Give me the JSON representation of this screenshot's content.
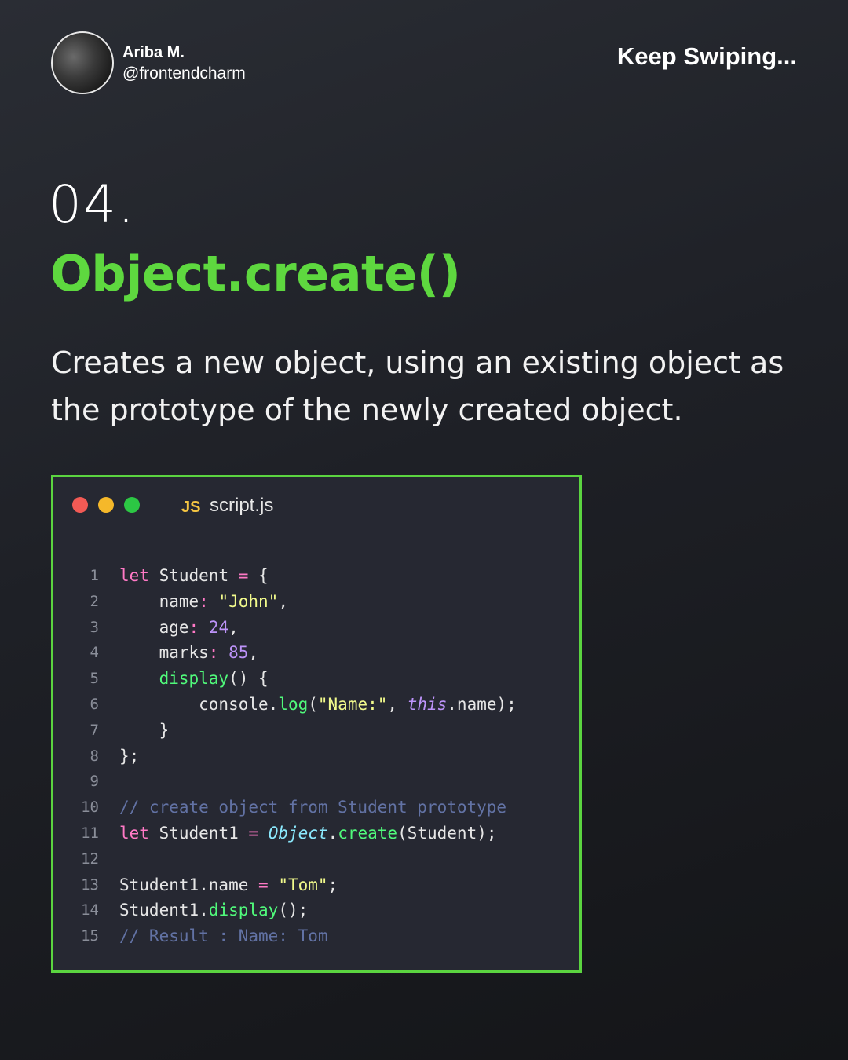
{
  "author": {
    "name": "Ariba M.",
    "handle": "@frontendcharm"
  },
  "header": {
    "cta": "Keep Swiping..."
  },
  "slide": {
    "number": "04.",
    "title": "Object.create()",
    "description": "Creates a new object, using an existing object as the prototype of the newly created object."
  },
  "editor": {
    "file_badge": "JS",
    "file_name": "script.js",
    "lines": [
      {
        "n": "1",
        "tokens": [
          [
            "keyword",
            "let"
          ],
          [
            "plain",
            " Student "
          ],
          [
            "op",
            "="
          ],
          [
            "plain",
            " {"
          ]
        ]
      },
      {
        "n": "2",
        "tokens": [
          [
            "plain",
            "    name"
          ],
          [
            "op",
            ":"
          ],
          [
            "plain",
            " "
          ],
          [
            "string",
            "\"John\""
          ],
          [
            "plain",
            ","
          ]
        ]
      },
      {
        "n": "3",
        "tokens": [
          [
            "plain",
            "    age"
          ],
          [
            "op",
            ":"
          ],
          [
            "plain",
            " "
          ],
          [
            "number",
            "24"
          ],
          [
            "plain",
            ","
          ]
        ]
      },
      {
        "n": "4",
        "tokens": [
          [
            "plain",
            "    marks"
          ],
          [
            "op",
            ":"
          ],
          [
            "plain",
            " "
          ],
          [
            "number",
            "85"
          ],
          [
            "plain",
            ","
          ]
        ]
      },
      {
        "n": "5",
        "tokens": [
          [
            "plain",
            "    "
          ],
          [
            "func",
            "display"
          ],
          [
            "plain",
            "() {"
          ]
        ]
      },
      {
        "n": "6",
        "tokens": [
          [
            "plain",
            "        console."
          ],
          [
            "func",
            "log"
          ],
          [
            "plain",
            "("
          ],
          [
            "string",
            "\"Name:\""
          ],
          [
            "plain",
            ", "
          ],
          [
            "this",
            "this"
          ],
          [
            "plain",
            ".name);"
          ]
        ]
      },
      {
        "n": "7",
        "tokens": [
          [
            "plain",
            "    }"
          ]
        ]
      },
      {
        "n": "8",
        "tokens": [
          [
            "plain",
            "};"
          ]
        ]
      },
      {
        "n": "9",
        "tokens": []
      },
      {
        "n": "10",
        "tokens": [
          [
            "comment",
            "// create object from Student prototype"
          ]
        ]
      },
      {
        "n": "11",
        "tokens": [
          [
            "keyword",
            "let"
          ],
          [
            "plain",
            " Student1 "
          ],
          [
            "op",
            "="
          ],
          [
            "plain",
            " "
          ],
          [
            "builtin",
            "Object"
          ],
          [
            "plain",
            "."
          ],
          [
            "func",
            "create"
          ],
          [
            "plain",
            "(Student);"
          ]
        ]
      },
      {
        "n": "12",
        "tokens": []
      },
      {
        "n": "13",
        "tokens": [
          [
            "plain",
            "Student1.name "
          ],
          [
            "op",
            "="
          ],
          [
            "plain",
            " "
          ],
          [
            "string",
            "\"Tom\""
          ],
          [
            "plain",
            ";"
          ]
        ]
      },
      {
        "n": "14",
        "tokens": [
          [
            "plain",
            "Student1."
          ],
          [
            "func",
            "display"
          ],
          [
            "plain",
            "();"
          ]
        ]
      },
      {
        "n": "15",
        "tokens": [
          [
            "comment",
            "// Result : Name: Tom"
          ]
        ]
      }
    ]
  },
  "colors": {
    "accent_green": "#5ed83f",
    "window_border": "#5bd440",
    "editor_bg": "#262832"
  }
}
